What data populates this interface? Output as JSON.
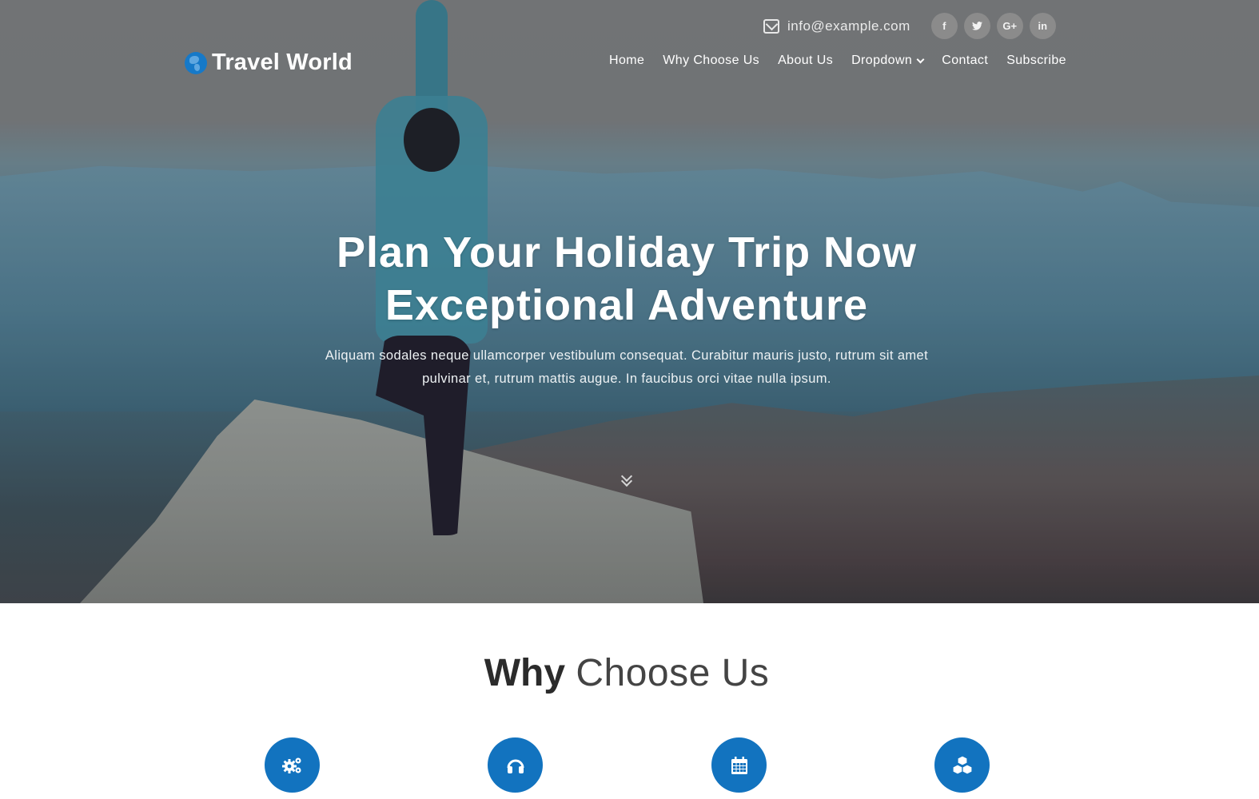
{
  "brand": {
    "name": "Travel World",
    "icon": "globe-icon",
    "accent": "#1679c8"
  },
  "topbar": {
    "email": "info@example.com",
    "email_icon": "envelope-open-icon",
    "socials": [
      {
        "name": "facebook",
        "glyph": "f"
      },
      {
        "name": "twitter",
        "glyph": "t"
      },
      {
        "name": "google-plus",
        "glyph": "G+"
      },
      {
        "name": "linkedin",
        "glyph": "in"
      }
    ]
  },
  "nav": {
    "items": [
      {
        "label": "Home"
      },
      {
        "label": "Why Choose Us"
      },
      {
        "label": "About Us"
      },
      {
        "label": "Dropdown",
        "has_dropdown": true
      },
      {
        "label": "Contact"
      },
      {
        "label": "Subscribe"
      }
    ]
  },
  "hero": {
    "title_line1": "Plan Your Holiday Trip Now",
    "title_line2": "Exceptional Adventure",
    "text": "Aliquam sodales neque ullamcorper vestibulum consequat. Curabitur mauris justo, rutrum sit amet pulvinar et, rutrum mattis augue. In faucibus orci vitae nulla ipsum.",
    "scroll_icon": "double-chevron-down-icon"
  },
  "why_section": {
    "title_bold": "Why",
    "title_light": "Choose Us",
    "feature_icons": [
      "gears-icon",
      "headphones-icon",
      "calendar-icon",
      "cubes-icon"
    ],
    "icon_color": "#1273bf"
  }
}
